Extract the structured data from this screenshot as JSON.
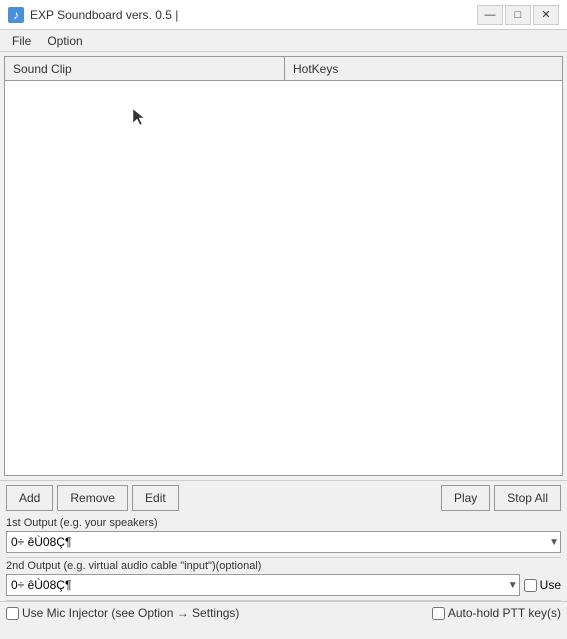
{
  "titleBar": {
    "icon": "♪",
    "title": "EXP Soundboard vers. 0.5  |",
    "minimizeBtn": "—",
    "maximizeBtn": "□",
    "closeBtn": "✕"
  },
  "menuBar": {
    "items": [
      "File",
      "Option"
    ]
  },
  "table": {
    "columns": [
      "Sound Clip",
      "HotKeys"
    ]
  },
  "buttons": {
    "add": "Add",
    "remove": "Remove",
    "edit": "Edit",
    "play": "Play",
    "stopAll": "Stop All"
  },
  "output1": {
    "label": "1st Output (e.g. your speakers)",
    "value": "0÷ êÙ08Ç¶"
  },
  "output2": {
    "label": "2nd Output (e.g. virtual audio cable \"input\")(optional)",
    "value": "0÷ êÙ08Ç¶",
    "useLabel": "Use"
  },
  "bottomOptions": {
    "micInjector": "Use Mic Injector (see Option → Settings)",
    "autoPTT": "Auto-hold PTT key(s)"
  }
}
